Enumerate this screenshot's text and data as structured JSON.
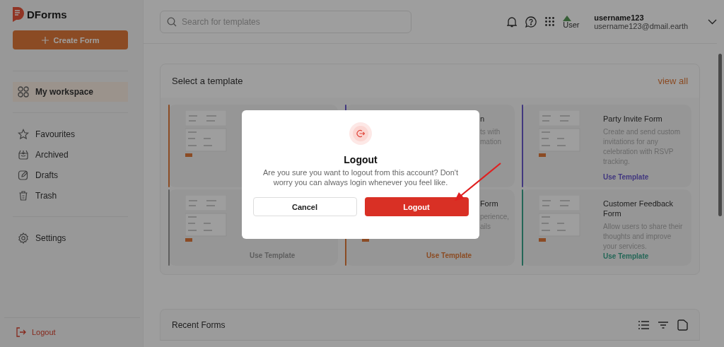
{
  "sidebar": {
    "logo_text": "DForms",
    "create_button": "Create Form",
    "sections": [
      [
        {
          "label": "My workspace",
          "selected": true
        }
      ],
      [
        {
          "label": "Favourites",
          "selected": false
        },
        {
          "label": "Archived",
          "selected": false
        },
        {
          "label": "Drafts",
          "selected": false
        },
        {
          "label": "Trash",
          "selected": false
        }
      ],
      [
        {
          "label": "Settings",
          "selected": false
        }
      ]
    ],
    "logout": "Logout"
  },
  "topbar": {
    "search": {
      "placeholder": "Search for templates"
    },
    "avatar_alt": "User",
    "username": "username123",
    "email": "username123@dmail.earth"
  },
  "templates": {
    "title": "Select a template",
    "link": "view all",
    "cards": [
      {
        "kind": "covered",
        "color": "#8b4c24"
      },
      {
        "kind": "fragment",
        "color": "#42387f",
        "title": "n",
        "description_lines": [
          "ts with",
          "mation"
        ]
      },
      {
        "kind": "full",
        "color": "#42387f",
        "title": "Party Invite Form",
        "description": "Create and send custom invitations for any celebration with RSVP tracking.",
        "action": "Use Template"
      },
      {
        "kind": "covered",
        "color": "#5f5f5f",
        "action": "Use Template"
      },
      {
        "kind": "covered",
        "color": "#8b4c24",
        "title": "Form",
        "description_lines": [
          "perience,",
          "ails"
        ],
        "action": "Use Template"
      },
      {
        "kind": "full",
        "color": "#246657",
        "title": "Customer Feedback Form",
        "description": "Allow users to share their thoughts and improve your services.",
        "action": "Use Template"
      }
    ]
  },
  "recent": {
    "title": "Recent Forms"
  },
  "modal": {
    "title": "Logout",
    "message": "Are you sure you want to logout from this account? Don't worry you can always login whenever you feel like.",
    "buttons": [
      {
        "label": "Cancel",
        "kind": "secondary"
      },
      {
        "label": "Logout",
        "kind": "danger"
      }
    ]
  }
}
